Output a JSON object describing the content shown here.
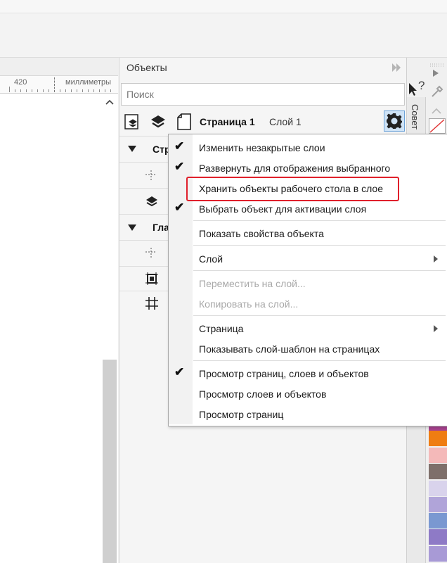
{
  "ruler": {
    "tick_value": "420",
    "units": "миллиметры"
  },
  "docker": {
    "title": "Объекты",
    "search_placeholder": "Поиск",
    "page_name": "Страница 1",
    "layer_name": "Слой 1",
    "tree": [
      {
        "label": "Стр",
        "expanded": true
      },
      {
        "label": "Гла",
        "expanded": true
      }
    ]
  },
  "right_strip": {
    "tab_label": "Совет",
    "help_glyph": "?"
  },
  "menu": {
    "items": [
      {
        "label": "Изменить незакрытые слои",
        "checked": true
      },
      {
        "label": "Развернуть для отображения выбранного",
        "checked": true
      },
      {
        "label": "Хранить объекты рабочего стола в слое",
        "checked": false,
        "highlighted": true
      },
      {
        "label": "Выбрать объект для активации слоя",
        "checked": true
      },
      {
        "label": "Показать свойства объекта",
        "checked": false
      },
      {
        "label": "Слой",
        "submenu": true
      },
      {
        "label": "Переместить на слой...",
        "disabled": true
      },
      {
        "label": "Копировать на слой...",
        "disabled": true
      },
      {
        "label": "Страница",
        "submenu": true
      },
      {
        "label": "Показывать слой-шаблон на страницах"
      },
      {
        "label": "Просмотр страниц, слоев и объектов",
        "checked": true
      },
      {
        "label": "Просмотр слоев и объектов"
      },
      {
        "label": "Просмотр страниц"
      }
    ]
  },
  "swatch_colors": [
    "#a8428f",
    "#ef7d12",
    "#f4b9b9",
    "#7e6f6a",
    "#d9d3ec",
    "#b0a4d9",
    "#7a98d1",
    "#8e7ac6",
    "#a89ad6"
  ],
  "accent": "#e0202b"
}
